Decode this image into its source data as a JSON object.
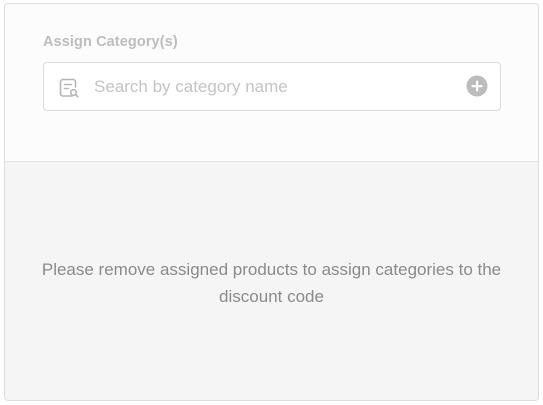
{
  "assign_category": {
    "label": "Assign Category(s)",
    "search": {
      "placeholder": "Search by category name",
      "value": "",
      "icon": "category-search-icon",
      "add_icon": "plus-circle-icon"
    }
  },
  "notice": {
    "message": "Please remove assigned products to assign categories to the discount code"
  },
  "colors": {
    "label": "#bdbdbd",
    "icon": "#b5b5b5",
    "notice_text": "#8a8a8a",
    "disabled_background": "#f5f5f5"
  }
}
